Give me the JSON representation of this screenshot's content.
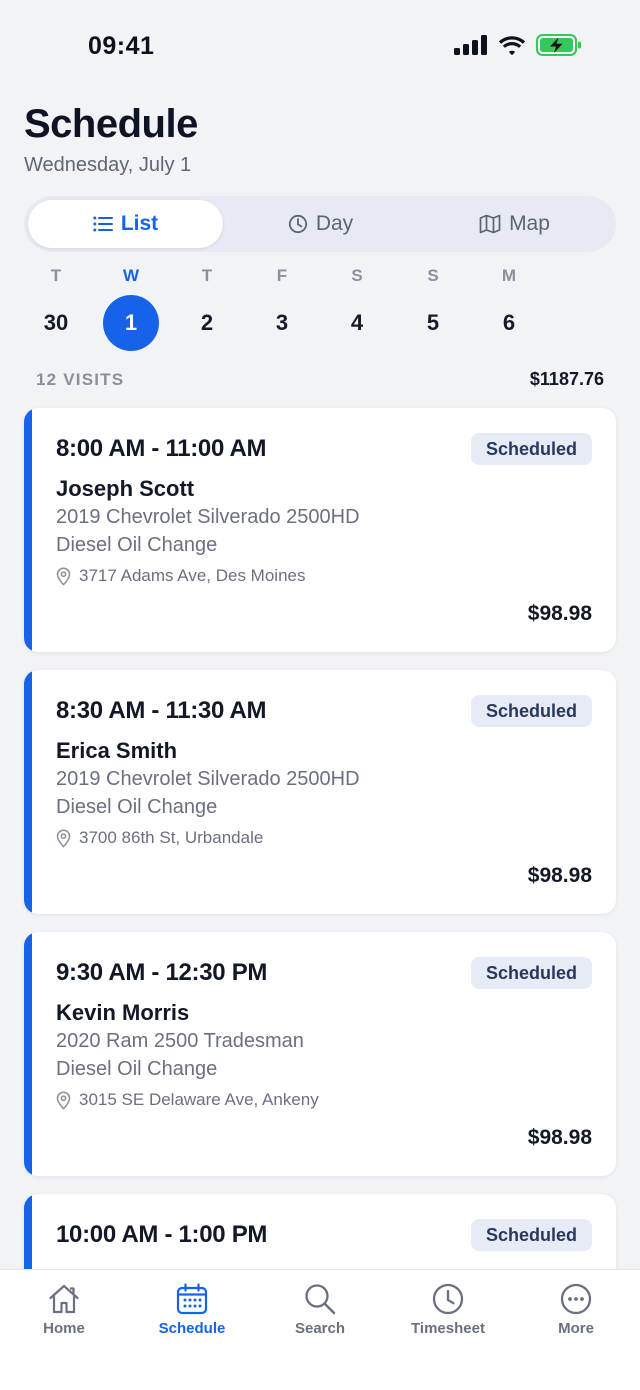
{
  "status_bar": {
    "time": "09:41"
  },
  "header": {
    "title": "Schedule",
    "subtitle": "Wednesday, July 1"
  },
  "view_tabs": [
    {
      "label": "List",
      "icon": "list-icon",
      "active": true
    },
    {
      "label": "Day",
      "icon": "clock-icon",
      "active": false
    },
    {
      "label": "Map",
      "icon": "map-icon",
      "active": false
    }
  ],
  "week": [
    {
      "dow": "T",
      "num": "30"
    },
    {
      "dow": "W",
      "num": "1",
      "selected": true
    },
    {
      "dow": "T",
      "num": "2"
    },
    {
      "dow": "F",
      "num": "3"
    },
    {
      "dow": "S",
      "num": "4"
    },
    {
      "dow": "S",
      "num": "5"
    },
    {
      "dow": "M",
      "num": "6"
    }
  ],
  "summary": {
    "visits": "12 VISITS",
    "total": "$1187.76"
  },
  "visits": [
    {
      "time": "8:00 AM - 11:00 AM",
      "status": "Scheduled",
      "customer": "Joseph Scott",
      "vehicle": "2019 Chevrolet Silverado 2500HD",
      "service": "Diesel Oil Change",
      "address": "3717 Adams Ave, Des Moines",
      "price": "$98.98"
    },
    {
      "time": "8:30 AM - 11:30 AM",
      "status": "Scheduled",
      "customer": "Erica Smith",
      "vehicle": "2019 Chevrolet Silverado 2500HD",
      "service": "Diesel Oil Change",
      "address": "3700 86th St, Urbandale",
      "price": "$98.98"
    },
    {
      "time": "9:30 AM - 12:30 PM",
      "status": "Scheduled",
      "customer": "Kevin Morris",
      "vehicle": "2020 Ram 2500 Tradesman",
      "service": "Diesel Oil Change",
      "address": "3015 SE Delaware Ave, Ankeny",
      "price": "$98.98"
    },
    {
      "time": "10:00 AM - 1:00 PM",
      "status": "Scheduled"
    }
  ],
  "tab_bar": [
    {
      "label": "Home",
      "icon": "home-icon"
    },
    {
      "label": "Schedule",
      "icon": "calendar-icon",
      "active": true
    },
    {
      "label": "Search",
      "icon": "search-icon"
    },
    {
      "label": "Timesheet",
      "icon": "clock-icon"
    },
    {
      "label": "More",
      "icon": "more-icon"
    }
  ],
  "colors": {
    "accent": "#1663ea",
    "background": "#f2f3f6",
    "badge_bg": "#e6ebf6",
    "badge_text": "#29385c",
    "battery": "#34c759"
  }
}
